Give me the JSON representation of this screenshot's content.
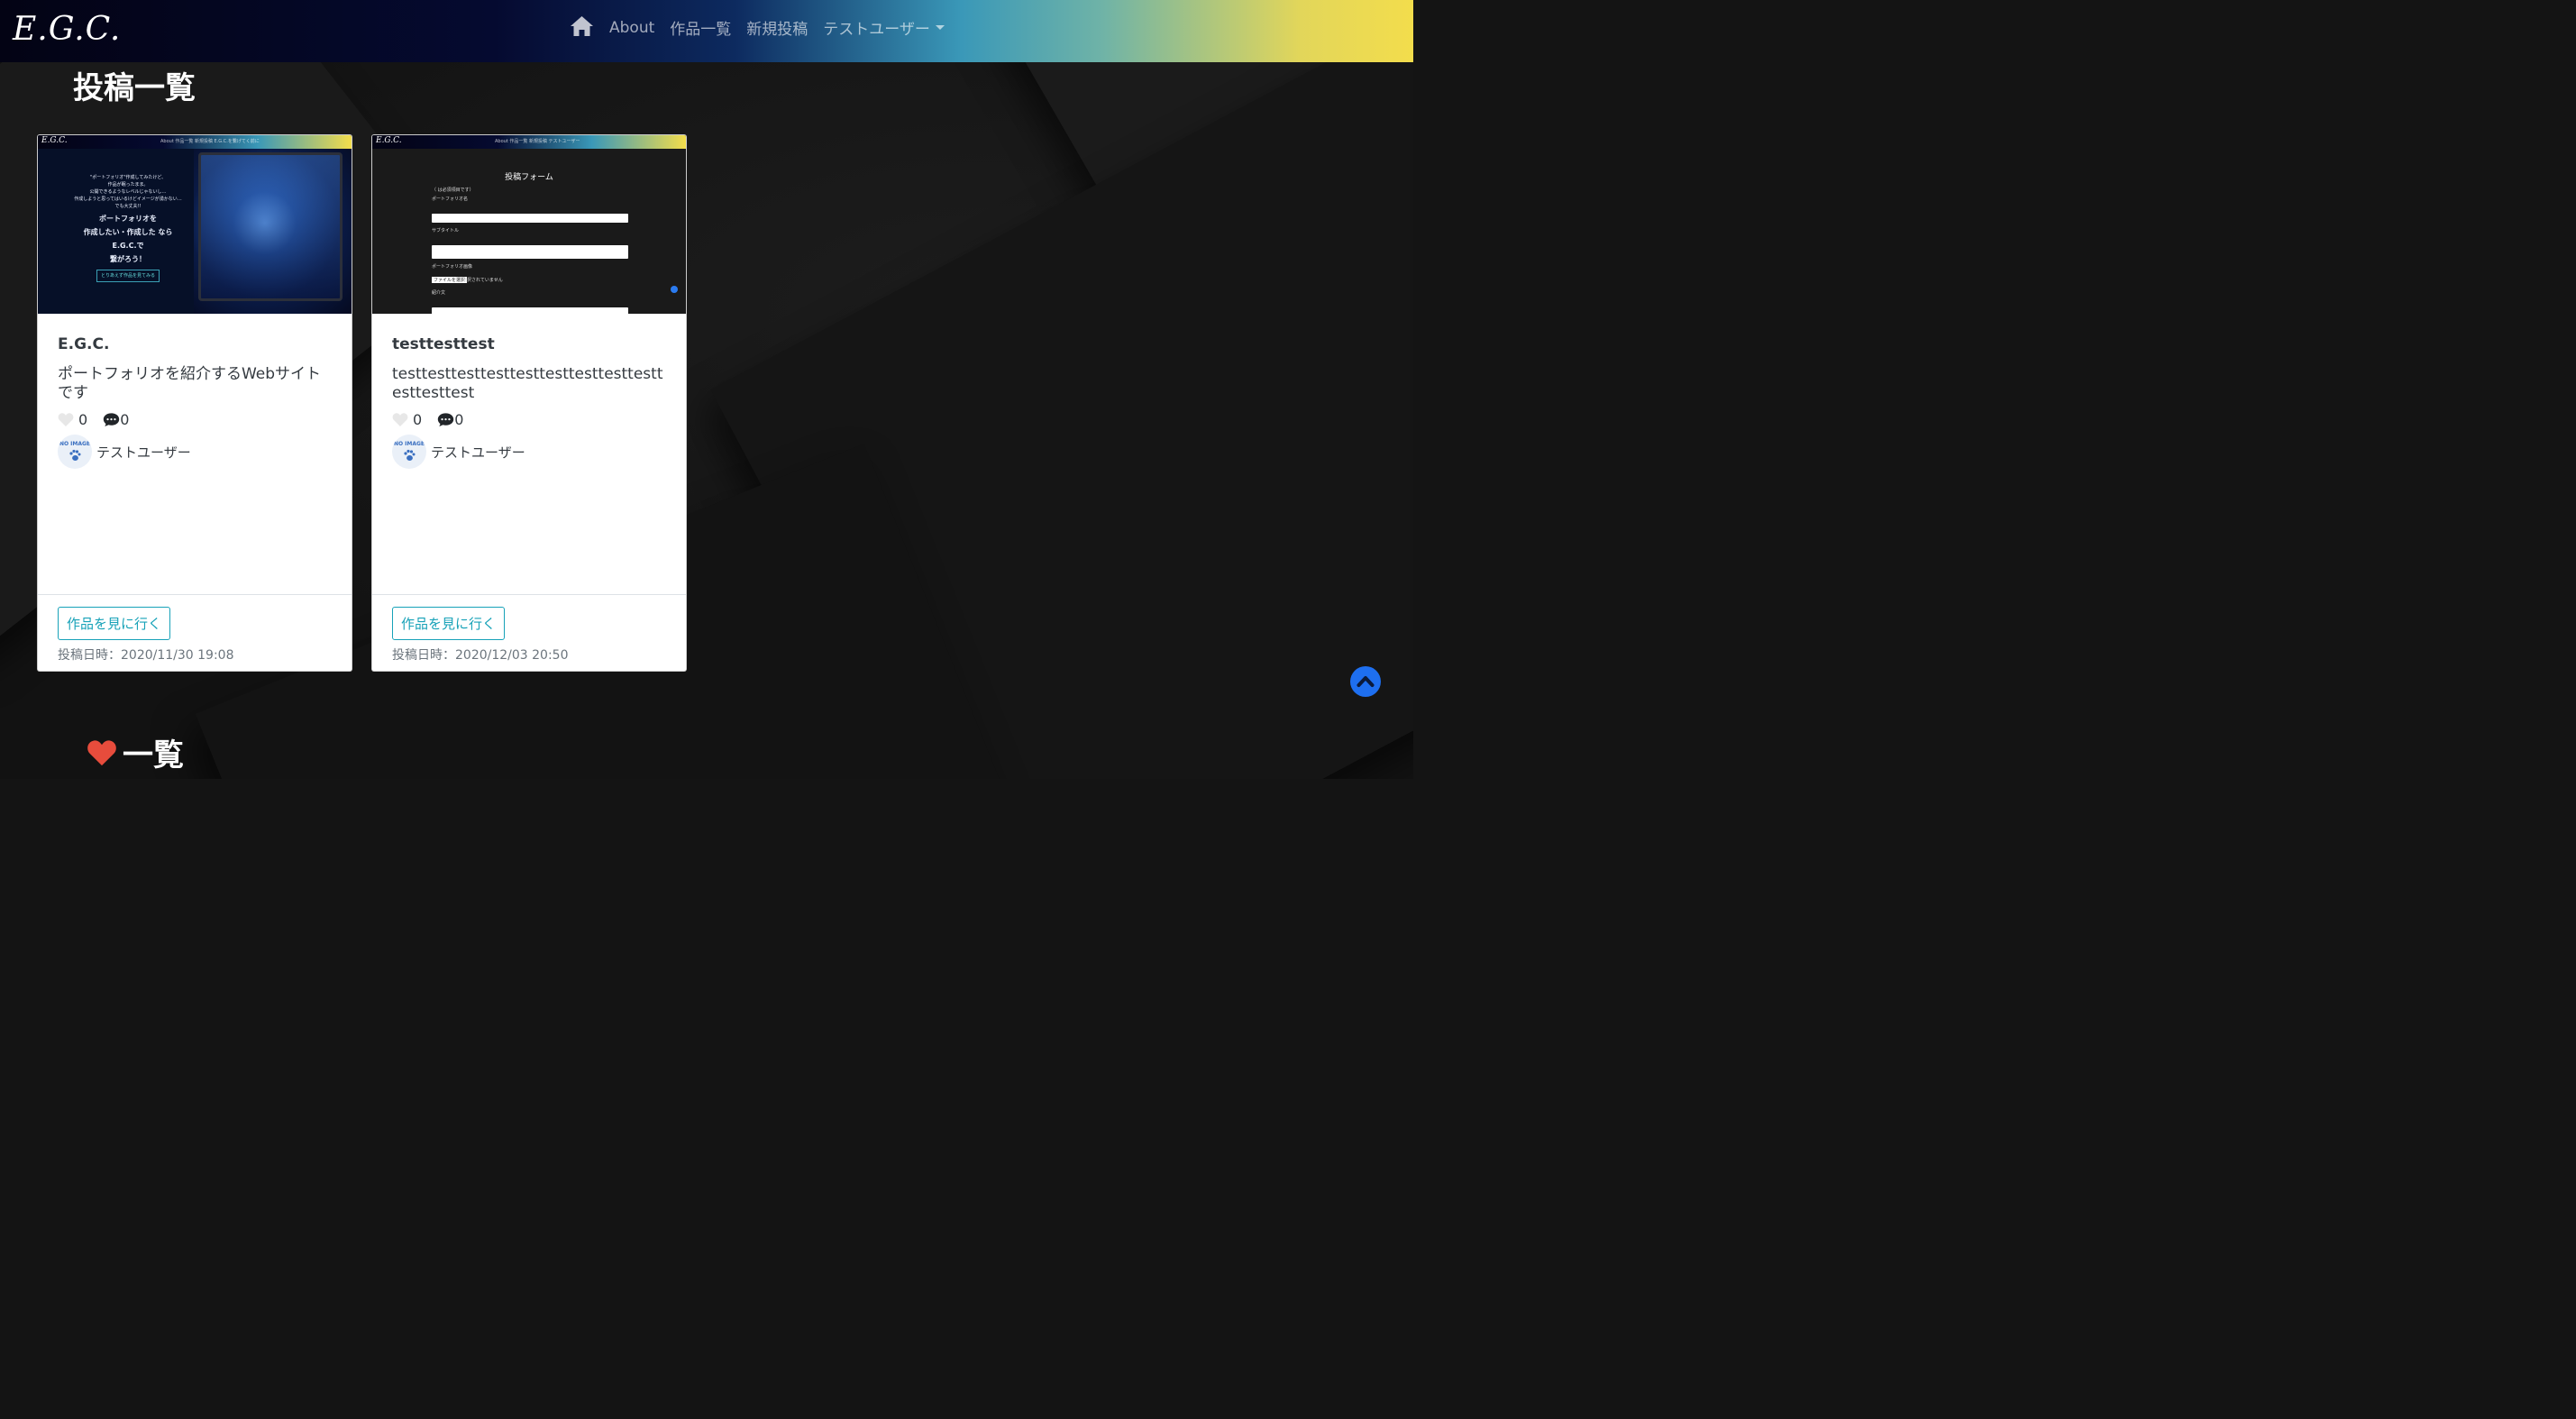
{
  "nav": {
    "logo": "E.G.C.",
    "home_icon": "home-icon",
    "about": "About",
    "works": "作品一覧",
    "new_post": "新規投稿",
    "user_menu": "テストユーザー"
  },
  "posts_section": {
    "title": "投稿一覧"
  },
  "favorites_section": {
    "title": "一覧",
    "icon": "heart-icon"
  },
  "colors": {
    "accent": "#17a2b8",
    "heart": "#e74c3c",
    "scroll_top": "#1e6ff0"
  },
  "cards": [
    {
      "thumb": {
        "logo": "E.G.C.",
        "nav": "About  作品一覧  新規投稿  E.G.C.を繋げてく前に",
        "lines": [
          "\"ポートフォリオ\"作成してみたけど、",
          "作品が眠ったまま。",
          "公開できるようなレベルじゃないし…",
          "作成しようと思ってはいるけどイメージが湧かない…",
          "でも大丈夫!!"
        ],
        "headline": [
          "ポートフォリオを",
          "作成したい・作成した なら",
          "E.G.C.で",
          "繋がろう！"
        ],
        "button": "とりあえず作品を見てみる"
      },
      "title": "E.G.C.",
      "text": "ポートフォリオを紹介するWebサイトです",
      "likes": "0",
      "comments": "0",
      "user": "テストユーザー",
      "avatar_label": "NO IMAGE",
      "button": "作品を見に行く",
      "posted": "投稿日時：2020/11/30 19:08"
    },
    {
      "thumb": {
        "logo": "E.G.C.",
        "nav": "About  作品一覧  新規投稿  テストユーザー",
        "form_title": "投稿フォーム",
        "required_note": "（ は必須項目です）",
        "labels": [
          "ポートフォリオ名",
          "サブタイトル",
          "ポートフォリオ画像",
          "紹介文"
        ],
        "file_button": "ファイルを選択",
        "file_note": "選択されていません"
      },
      "title": "testtesttest",
      "text": "testtesttesttesttesttesttesttesttesttesttesttest",
      "likes": "0",
      "comments": "0",
      "user": "テストユーザー",
      "avatar_label": "NO IMAGE",
      "button": "作品を見に行く",
      "posted": "投稿日時：2020/12/03 20:50"
    }
  ]
}
